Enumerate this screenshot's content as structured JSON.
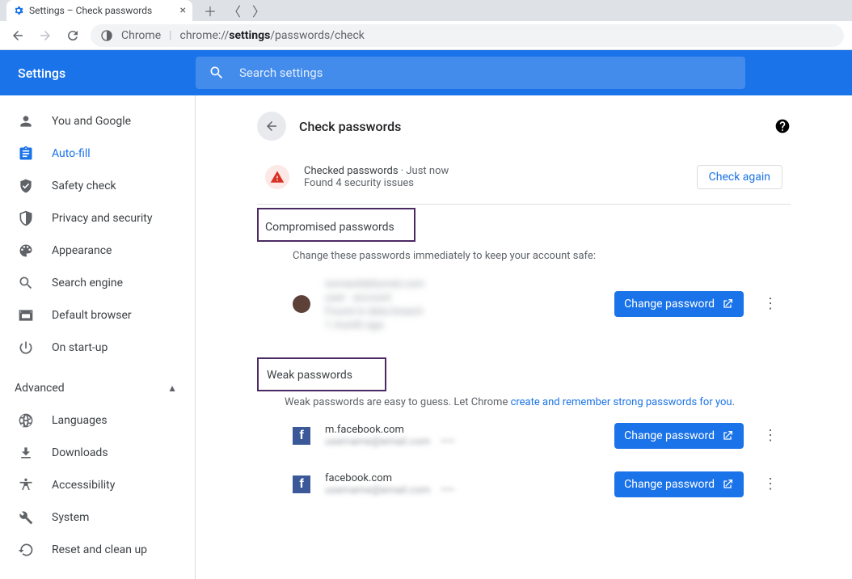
{
  "browser": {
    "tab_title": "Settings – Check passwords",
    "url_prefix": "Chrome",
    "url_path": "chrome://",
    "url_bold": "settings",
    "url_rest": "/passwords/check"
  },
  "header": {
    "title": "Settings",
    "search_placeholder": "Search settings"
  },
  "sidebar": {
    "items": [
      {
        "label": "You and Google",
        "icon": "person"
      },
      {
        "label": "Auto-fill",
        "icon": "clipboard",
        "active": true
      },
      {
        "label": "Safety check",
        "icon": "shieldcheck"
      },
      {
        "label": "Privacy and security",
        "icon": "shield"
      },
      {
        "label": "Appearance",
        "icon": "palette"
      },
      {
        "label": "Search engine",
        "icon": "search"
      },
      {
        "label": "Default browser",
        "icon": "browser"
      },
      {
        "label": "On start-up",
        "icon": "power"
      }
    ],
    "advanced_label": "Advanced",
    "advanced_items": [
      {
        "label": "Languages",
        "icon": "globe"
      },
      {
        "label": "Downloads",
        "icon": "download"
      },
      {
        "label": "Accessibility",
        "icon": "accessibility"
      },
      {
        "label": "System",
        "icon": "wrench"
      },
      {
        "label": "Reset and clean up",
        "icon": "restore"
      }
    ]
  },
  "page": {
    "title": "Check passwords",
    "status_line1a": "Checked passwords",
    "status_line1b": " · Just now",
    "status_line2": "Found 4 security issues",
    "check_again": "Check again"
  },
  "compromised": {
    "heading": "Compromised passwords",
    "desc": "Change these passwords immediately to keep your account safe:",
    "change_label": "Change password",
    "entries": [
      {
        "site_blurred": "████████████",
        "detail_blurred": "████ ████\n██████████\n████ ███"
      }
    ]
  },
  "weak": {
    "heading": "Weak passwords",
    "desc_a": "Weak passwords are easy to guess. Let Chrome ",
    "desc_link": "create and remember strong passwords for you",
    "desc_b": ".",
    "change_label": "Change password",
    "entries": [
      {
        "site": "m.facebook.com",
        "detail_blurred": "████████████   ████"
      },
      {
        "site": "facebook.com",
        "detail_blurred": "████████████   ████"
      }
    ]
  }
}
